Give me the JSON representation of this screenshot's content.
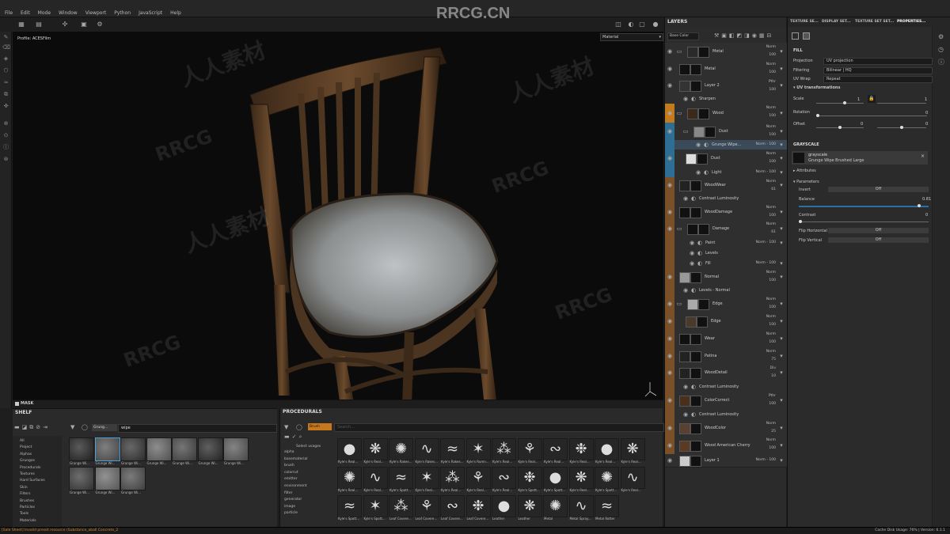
{
  "menu": [
    "File",
    "Edit",
    "Mode",
    "Window",
    "Viewport",
    "Python",
    "JavaScript",
    "Help"
  ],
  "watermark_top": "RRCG.CN",
  "viewport": {
    "profile": "Profile: ACESFilm",
    "channel": "Material",
    "mask_label": "MASK"
  },
  "layers_panel": {
    "title": "LAYERS",
    "channel_select": "Base Color",
    "rows": [
      {
        "name": "Metal",
        "blend": "Norm",
        "opacity": "100"
      },
      {
        "name": "Metal",
        "blend": "Norm",
        "opacity": "100"
      },
      {
        "name": "Layer 2",
        "blend": "Pthr",
        "opacity": "100"
      },
      {
        "name": "Sharpen",
        "blend": "",
        "opacity": ""
      },
      {
        "name": "Wood",
        "blend": "Norm",
        "opacity": "100"
      },
      {
        "name": "Dust",
        "blend": "Norm",
        "opacity": "100"
      },
      {
        "name": "Grunge Wipe...",
        "blend": "Norm",
        "opacity": "100"
      },
      {
        "name": "Dust",
        "blend": "Norm",
        "opacity": "100"
      },
      {
        "name": "Light",
        "blend": "Norm",
        "opacity": "100"
      },
      {
        "name": "WoodWear",
        "blend": "Norm",
        "opacity": "61"
      },
      {
        "name": "Contrast Luminosity",
        "blend": "",
        "opacity": ""
      },
      {
        "name": "WoodDamage",
        "blend": "Norm",
        "opacity": "100"
      },
      {
        "name": "Damage",
        "blend": "Norm",
        "opacity": "61"
      },
      {
        "name": "Paint",
        "blend": "Norm",
        "opacity": "100"
      },
      {
        "name": "Levels",
        "blend": "",
        "opacity": ""
      },
      {
        "name": "Fill",
        "blend": "Norm",
        "opacity": "100"
      },
      {
        "name": "Normal",
        "blend": "Norm",
        "opacity": "100"
      },
      {
        "name": "Levels - Normal",
        "blend": "",
        "opacity": ""
      },
      {
        "name": "Edge",
        "blend": "Norm",
        "opacity": "100"
      },
      {
        "name": "Edge",
        "blend": "Norm",
        "opacity": "100"
      },
      {
        "name": "Wear",
        "blend": "Norm",
        "opacity": "100"
      },
      {
        "name": "Patina",
        "blend": "Norm",
        "opacity": "75"
      },
      {
        "name": "WoodDetail",
        "blend": "Div",
        "opacity": "10"
      },
      {
        "name": "Contrast Luminosity",
        "blend": "",
        "opacity": ""
      },
      {
        "name": "ColorCorrect",
        "blend": "Pthr",
        "opacity": "100"
      },
      {
        "name": "Contrast Luminosity",
        "blend": "",
        "opacity": ""
      },
      {
        "name": "WoodColor",
        "blend": "Norm",
        "opacity": "25"
      },
      {
        "name": "Wood American Cherry",
        "blend": "Norm",
        "opacity": "100"
      },
      {
        "name": "Layer 1",
        "blend": "Norm",
        "opacity": "100"
      }
    ]
  },
  "props_tabs": [
    "TEXTURE SE...",
    "DISPLAY SET...",
    "TEXTURE SET SET...",
    "PROPERTIES..."
  ],
  "properties": {
    "section_fill": "FILL",
    "projection_label": "Projection",
    "projection_value": "UV projection",
    "filtering_label": "Filtering",
    "filtering_value": "Bilinear | HQ",
    "uvwrap_label": "UV Wrap",
    "uvwrap_value": "Repeat",
    "uv_transform": "UV transformations",
    "scale_label": "Scale",
    "scale_value": "1",
    "scale_value2": "1",
    "rotation_label": "Rotation",
    "rotation_value": "0",
    "offset_label": "Offset",
    "offset_value": "0",
    "offset_value2": "0",
    "section_grayscale": "GRAYSCALE",
    "gs_name": "grayscale",
    "gs_sub": "Grunge Wipe Brushed Large",
    "attributes": "Attributes",
    "parameters": "Parameters",
    "invert_label": "Invert",
    "invert_value": "Off",
    "balance_label": "Balance",
    "balance_value": "0.81",
    "balance_fraction": 0.95,
    "contrast_label": "Contrast",
    "contrast_value": "0",
    "fliph_label": "Flip Horizontal",
    "fliph_value": "Off",
    "flipv_label": "Flip Vertical",
    "flipv_value": "Off"
  },
  "shelf": {
    "title": "SHELF",
    "search_tag": "Grung...",
    "search_text": "wipe",
    "categories": [
      "All",
      "Project",
      "Alphas",
      "Grunges",
      "Procedurals",
      "Textures",
      "Hard Surfaces",
      "Skin",
      "Filters",
      "Brushes",
      "Particles",
      "Tools",
      "Materials"
    ],
    "tiles": [
      "Grunge Wi...",
      "Grunge Wi...",
      "Grunge Wi...",
      "Grunge Wi...",
      "Grunge Wi...",
      "Grunge Wi...",
      "Grunge Wi...",
      "Grunge Wi...",
      "Grunge Wi...",
      "Grunge Wi..."
    ]
  },
  "procedurals": {
    "title": "PROCEDURALS",
    "search_tag": "Brush",
    "search_placeholder": "Search...",
    "usage_label": "Select usages",
    "usages": [
      "alpha",
      "basematerial",
      "brush",
      "colorrut",
      "emitter",
      "environment",
      "filter",
      "generator",
      "image",
      "particle"
    ],
    "tiles": [
      "Kyle's Real...",
      "Kyle's Real...",
      "Kyle's Rakes...",
      "Kyle's Rakes...",
      "Kyle's Rakes...",
      "Kyle's Rumn...",
      "Kyle's Real...",
      "Kyle's Real...",
      "Kyle's Real...",
      "Kyle's Real...",
      "Kyle's Real...",
      "Kyle's Real...",
      "Kyle's Real...",
      "Kyle's Real...",
      "Kyle's Spott...",
      "Kyle's Real...",
      "Kyle's Real...",
      "Kyle's Real...",
      "Kyle's Real...",
      "Kyle's Spott...",
      "Kyle's Spott...",
      "Kyle's Real...",
      "Kyle's Spott...",
      "Kyle's Real...",
      "Kyle's Spott...",
      "Kyle's Spott...",
      "Leaf Covere...",
      "Leaf Covere...",
      "Leaf Covere...",
      "Leaf Covere...",
      "Leather",
      "Leather",
      "Metal",
      "Metal Spray...",
      "Metal Rotter"
    ]
  },
  "status": {
    "left": "[Sale Sheet] Invalid preset resource (Substance_aball Concrete_2",
    "right": "Cache Disk Usage: 76% | Version: 6.1.1"
  }
}
